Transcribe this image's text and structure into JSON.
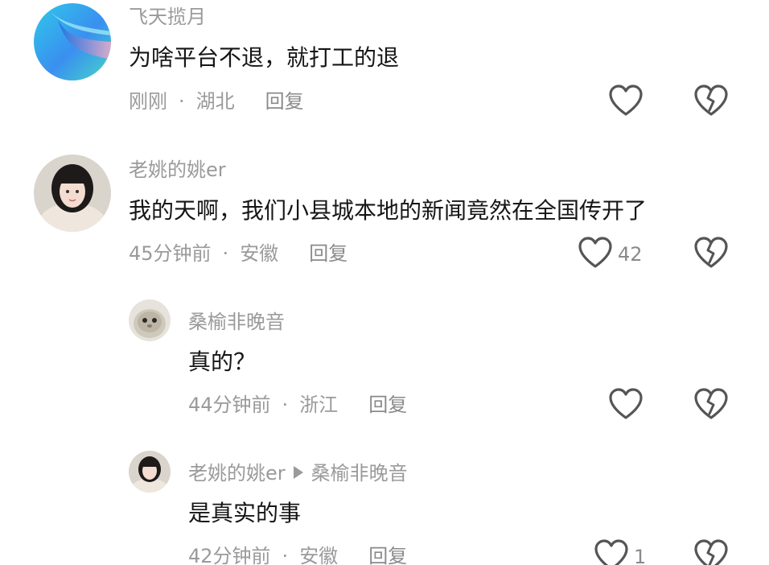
{
  "comments": [
    {
      "username": "飞天揽月",
      "text": "为啥平台不退，就打工的退",
      "time": "刚刚",
      "location": "湖北",
      "reply_label": "回复",
      "like_count": "",
      "avatar": "blue-swirl-avatar"
    },
    {
      "username": "老姚的姚er",
      "text": "我的天啊，我们小县城本地的新闻竟然在全国传开了",
      "time": "45分钟前",
      "location": "安徽",
      "reply_label": "回复",
      "like_count": "42",
      "avatar": "woman-portrait-avatar"
    },
    {
      "username": "桑榆非晚音",
      "text": "真的？",
      "time": "44分钟前",
      "location": "浙江",
      "reply_label": "回复",
      "like_count": "",
      "avatar": "round-creature-avatar"
    },
    {
      "username": "老姚的姚er",
      "reply_to": "桑榆非晚音",
      "text": "是真实的事",
      "time": "42分钟前",
      "location": "安徽",
      "reply_label": "回复",
      "like_count": "1",
      "avatar": "woman-portrait-avatar"
    }
  ],
  "separator": "·",
  "icons": {
    "like": "heart-outline-icon",
    "dislike": "broken-heart-icon"
  },
  "colors": {
    "username": "#9a9a9a",
    "text": "#161616",
    "meta": "#9a9a9a",
    "icon_stroke": "#555555",
    "background": "#ffffff"
  }
}
